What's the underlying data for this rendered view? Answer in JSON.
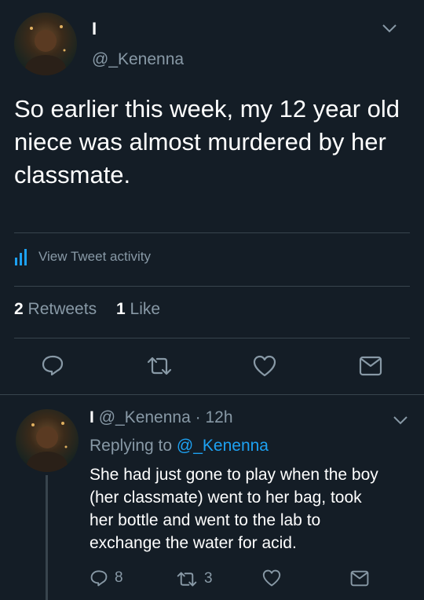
{
  "main_tweet": {
    "display_name": "I",
    "handle": "@_Kenenna",
    "text": "So earlier this week, my 12 year old niece was almost murdered by her classmate.",
    "activity_label": "View Tweet activity",
    "retweet_count": "2",
    "retweet_label": "Retweets",
    "like_count": "1",
    "like_label": "Like"
  },
  "reply_tweet": {
    "display_name": "I",
    "handle": "@_Kenenna",
    "separator": "·",
    "time": "12h",
    "replying_prefix": "Replying to",
    "replying_handle": "@_Kenenna",
    "text_lines": [
      "She had just gone to play when the boy",
      "(her classmate) went to her bag, took",
      "her bottle and went to the lab to",
      "exchange the water for acid."
    ],
    "reply_count": "8",
    "retweet_count": "3"
  },
  "colors": {
    "background": "#141d26",
    "text": "#ffffff",
    "muted": "#8899a6",
    "accent": "#1da1f2",
    "divider": "#38444d"
  },
  "icons": [
    "chevron-down-icon",
    "activity-bars-icon",
    "reply-icon",
    "retweet-icon",
    "like-icon",
    "direct-message-icon"
  ]
}
